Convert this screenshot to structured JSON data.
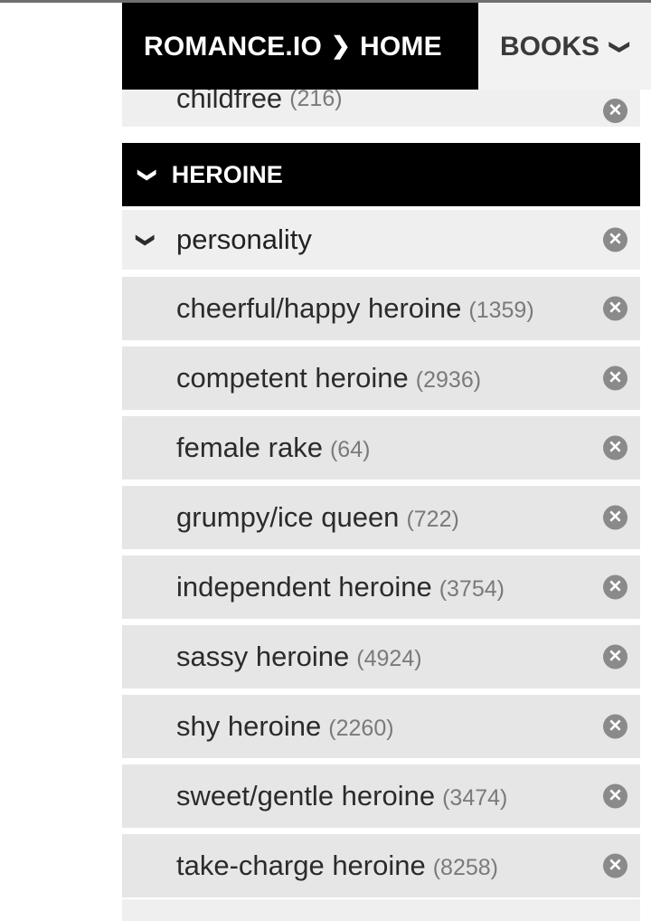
{
  "header": {
    "breadcrumb_site": "ROMANCE.IO",
    "breadcrumb_sep": "❯",
    "breadcrumb_page": "HOME",
    "books_label": "BOOKS",
    "books_chevron": "❯"
  },
  "clipped_row": {
    "label": "childfree",
    "count": "(216)"
  },
  "section": {
    "chevron": "❯",
    "title": "HEROINE"
  },
  "group": {
    "chevron": "❯",
    "label": "personality"
  },
  "items": [
    {
      "label": "cheerful/happy heroine",
      "count": "(1359)"
    },
    {
      "label": "competent heroine",
      "count": "(2936)"
    },
    {
      "label": "female rake",
      "count": "(64)"
    },
    {
      "label": "grumpy/ice queen",
      "count": "(722)"
    },
    {
      "label": "independent heroine",
      "count": "(3754)"
    },
    {
      "label": "sassy heroine",
      "count": "(4924)"
    },
    {
      "label": "shy heroine",
      "count": "(2260)"
    },
    {
      "label": "sweet/gentle heroine",
      "count": "(3474)"
    },
    {
      "label": "take-charge heroine",
      "count": "(8258)"
    }
  ],
  "remove_glyph": "✕",
  "colors": {
    "header_black": "#000000",
    "row_bg": "#e6e6e6",
    "remove_icon": "#8a8a8a"
  }
}
